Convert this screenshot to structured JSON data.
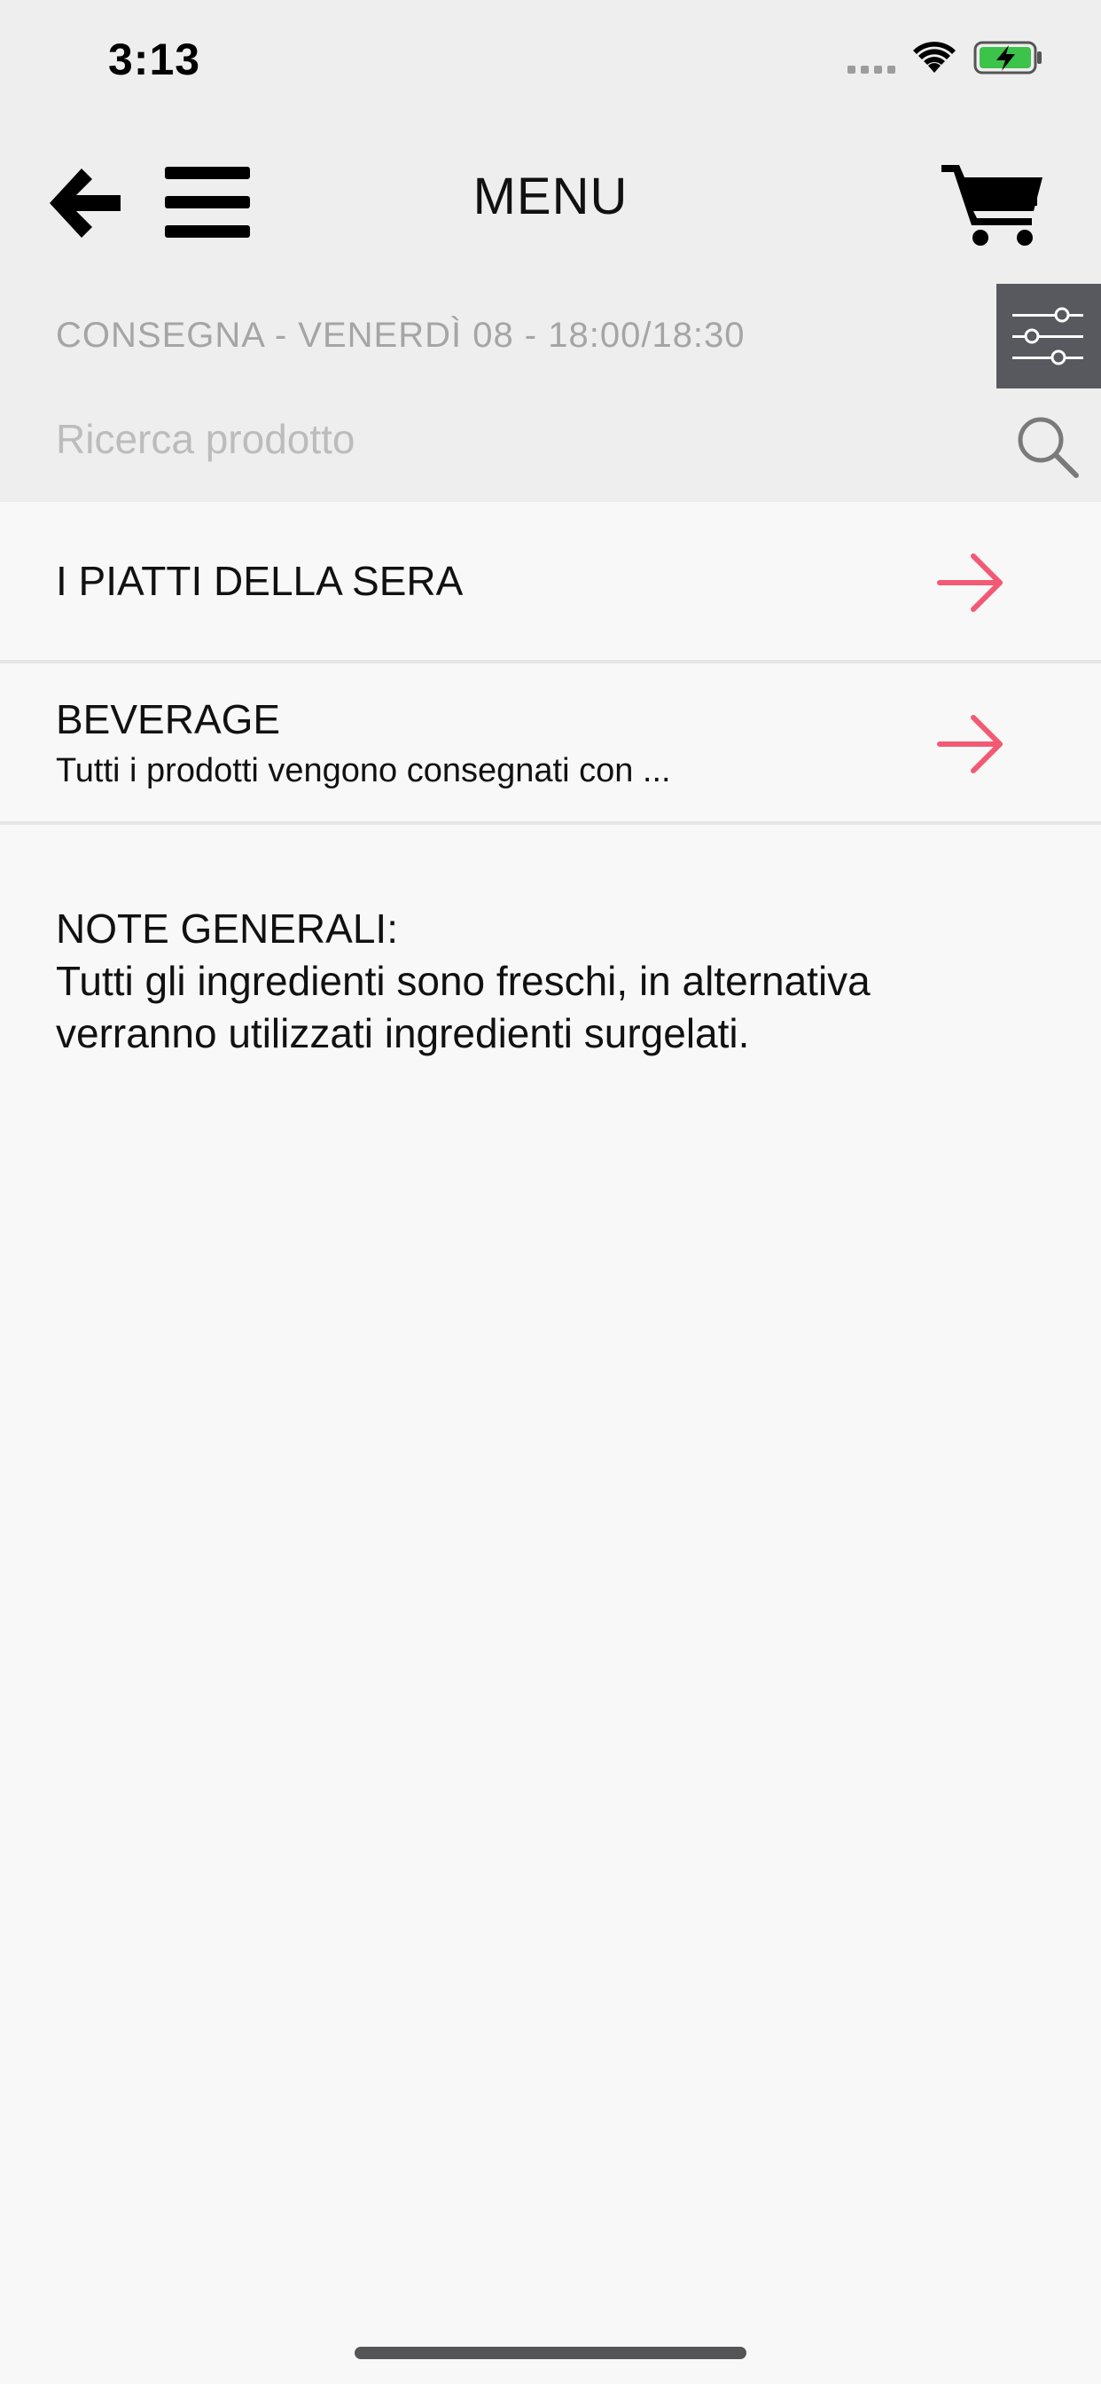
{
  "status_bar": {
    "time": "3:13"
  },
  "header": {
    "title": "MENU"
  },
  "delivery": {
    "text": "CONSEGNA - VENERDÌ 08 - 18:00/18:30"
  },
  "search": {
    "placeholder": "Ricerca prodotto",
    "value": ""
  },
  "categories": [
    {
      "name": "I PIATTI DELLA SERA",
      "description": ""
    },
    {
      "name": "BEVERAGE",
      "description": "Tutti i prodotti vengono consegnati con ..."
    }
  ],
  "notes": {
    "title": "NOTE GENERALI:",
    "line1": "Tutti gli ingredienti sono freschi, in alternativa",
    "line2": "verranno utilizzati ingredienti surgelati."
  },
  "colors": {
    "accent_arrow": "#f25a74",
    "header_bg": "#eeeeee",
    "filter_bg": "#58595e",
    "battery_green": "#3bc34a"
  },
  "icons": {
    "back": "arrow-left-icon",
    "menu": "hamburger-icon",
    "cart": "cart-icon",
    "filter": "sliders-icon",
    "search": "magnifier-icon",
    "row_action": "arrow-right-icon"
  }
}
